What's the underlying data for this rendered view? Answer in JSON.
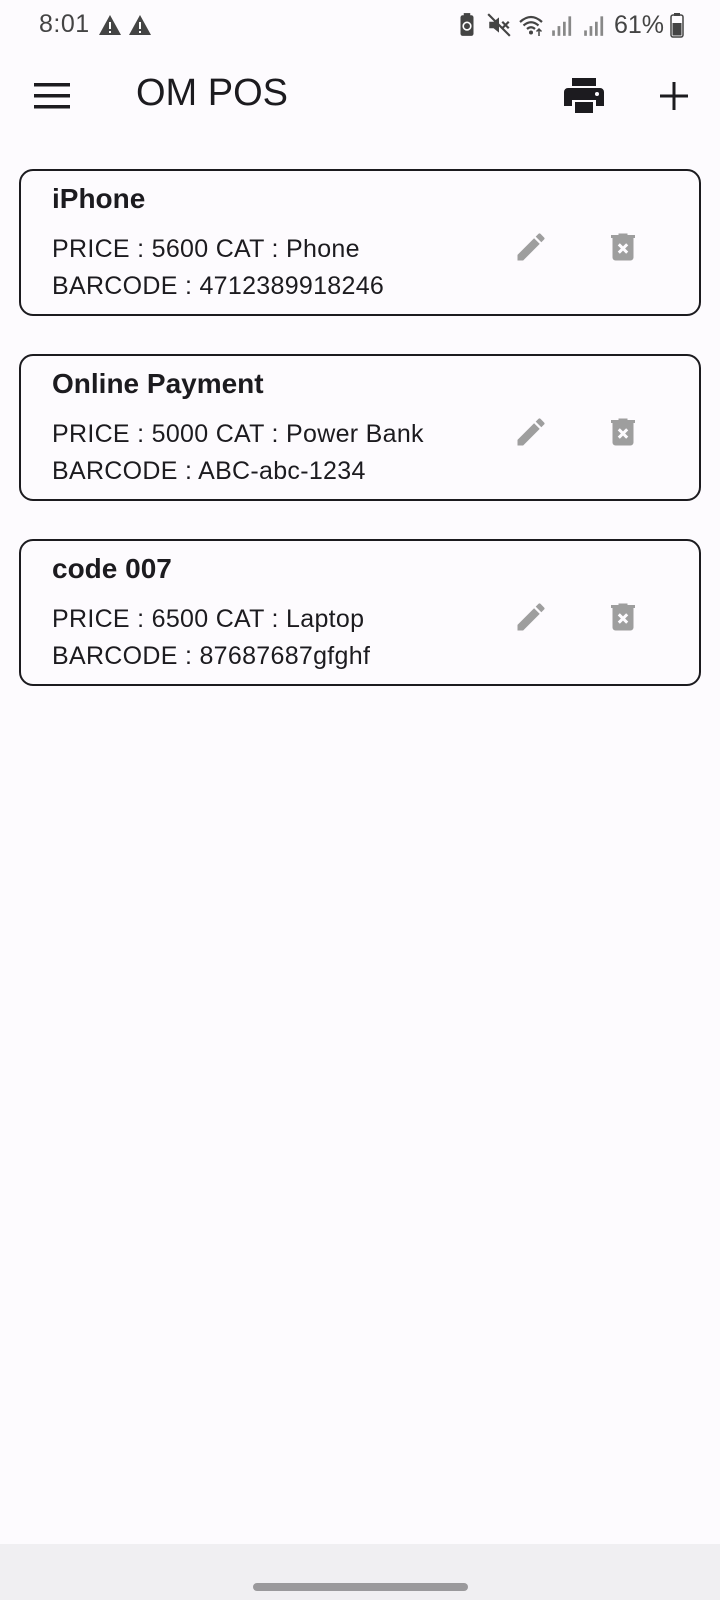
{
  "status_bar": {
    "time": "8:01",
    "battery_text": "61%",
    "icons": [
      "alert-icon",
      "alert-icon",
      "battery-saver-icon",
      "mute-icon",
      "wifi-icon",
      "signal-icon",
      "signal-icon",
      "battery-icon"
    ]
  },
  "app_bar": {
    "title": "OM POS",
    "icons": [
      "menu-icon",
      "print-icon",
      "add-icon"
    ]
  },
  "products": [
    {
      "name": "iPhone",
      "line1": "PRICE : 5600 CAT : Phone",
      "line2": "BARCODE : 4712389918246"
    },
    {
      "name": "Online Payment",
      "line1": "PRICE : 5000 CAT : Power Bank",
      "line2": "BARCODE : ABC-abc-1234"
    },
    {
      "name": "code 007",
      "line1": "PRICE : 6500 CAT : Laptop",
      "line2": "BARCODE : 87687687gfghf"
    }
  ],
  "colors": {
    "background": "#fdfbfe",
    "text": "#1c1b1f",
    "icon_muted": "#9e9e9e",
    "card_border": "#1c1b1f"
  }
}
